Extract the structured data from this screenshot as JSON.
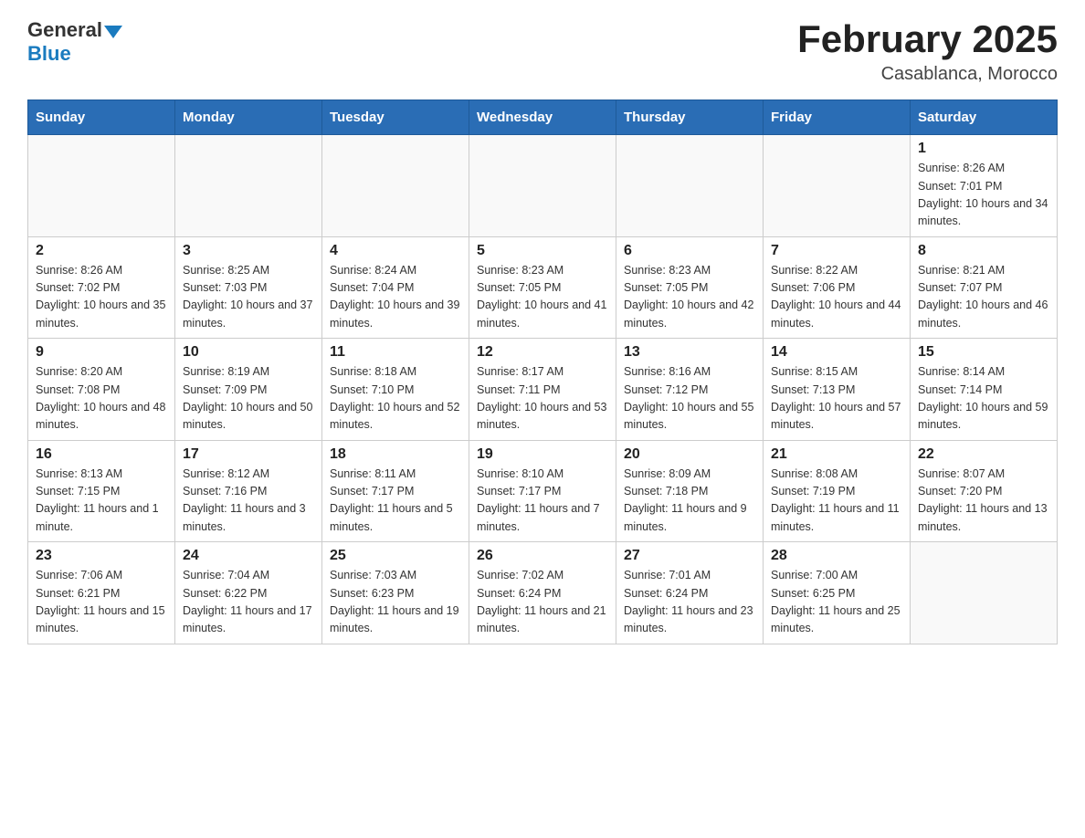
{
  "header": {
    "logo_general": "General",
    "logo_blue": "Blue",
    "month_title": "February 2025",
    "location": "Casablanca, Morocco"
  },
  "weekdays": [
    "Sunday",
    "Monday",
    "Tuesday",
    "Wednesday",
    "Thursday",
    "Friday",
    "Saturday"
  ],
  "weeks": [
    [
      {
        "day": "",
        "info": ""
      },
      {
        "day": "",
        "info": ""
      },
      {
        "day": "",
        "info": ""
      },
      {
        "day": "",
        "info": ""
      },
      {
        "day": "",
        "info": ""
      },
      {
        "day": "",
        "info": ""
      },
      {
        "day": "1",
        "info": "Sunrise: 8:26 AM\nSunset: 7:01 PM\nDaylight: 10 hours and 34 minutes."
      }
    ],
    [
      {
        "day": "2",
        "info": "Sunrise: 8:26 AM\nSunset: 7:02 PM\nDaylight: 10 hours and 35 minutes."
      },
      {
        "day": "3",
        "info": "Sunrise: 8:25 AM\nSunset: 7:03 PM\nDaylight: 10 hours and 37 minutes."
      },
      {
        "day": "4",
        "info": "Sunrise: 8:24 AM\nSunset: 7:04 PM\nDaylight: 10 hours and 39 minutes."
      },
      {
        "day": "5",
        "info": "Sunrise: 8:23 AM\nSunset: 7:05 PM\nDaylight: 10 hours and 41 minutes."
      },
      {
        "day": "6",
        "info": "Sunrise: 8:23 AM\nSunset: 7:05 PM\nDaylight: 10 hours and 42 minutes."
      },
      {
        "day": "7",
        "info": "Sunrise: 8:22 AM\nSunset: 7:06 PM\nDaylight: 10 hours and 44 minutes."
      },
      {
        "day": "8",
        "info": "Sunrise: 8:21 AM\nSunset: 7:07 PM\nDaylight: 10 hours and 46 minutes."
      }
    ],
    [
      {
        "day": "9",
        "info": "Sunrise: 8:20 AM\nSunset: 7:08 PM\nDaylight: 10 hours and 48 minutes."
      },
      {
        "day": "10",
        "info": "Sunrise: 8:19 AM\nSunset: 7:09 PM\nDaylight: 10 hours and 50 minutes."
      },
      {
        "day": "11",
        "info": "Sunrise: 8:18 AM\nSunset: 7:10 PM\nDaylight: 10 hours and 52 minutes."
      },
      {
        "day": "12",
        "info": "Sunrise: 8:17 AM\nSunset: 7:11 PM\nDaylight: 10 hours and 53 minutes."
      },
      {
        "day": "13",
        "info": "Sunrise: 8:16 AM\nSunset: 7:12 PM\nDaylight: 10 hours and 55 minutes."
      },
      {
        "day": "14",
        "info": "Sunrise: 8:15 AM\nSunset: 7:13 PM\nDaylight: 10 hours and 57 minutes."
      },
      {
        "day": "15",
        "info": "Sunrise: 8:14 AM\nSunset: 7:14 PM\nDaylight: 10 hours and 59 minutes."
      }
    ],
    [
      {
        "day": "16",
        "info": "Sunrise: 8:13 AM\nSunset: 7:15 PM\nDaylight: 11 hours and 1 minute."
      },
      {
        "day": "17",
        "info": "Sunrise: 8:12 AM\nSunset: 7:16 PM\nDaylight: 11 hours and 3 minutes."
      },
      {
        "day": "18",
        "info": "Sunrise: 8:11 AM\nSunset: 7:17 PM\nDaylight: 11 hours and 5 minutes."
      },
      {
        "day": "19",
        "info": "Sunrise: 8:10 AM\nSunset: 7:17 PM\nDaylight: 11 hours and 7 minutes."
      },
      {
        "day": "20",
        "info": "Sunrise: 8:09 AM\nSunset: 7:18 PM\nDaylight: 11 hours and 9 minutes."
      },
      {
        "day": "21",
        "info": "Sunrise: 8:08 AM\nSunset: 7:19 PM\nDaylight: 11 hours and 11 minutes."
      },
      {
        "day": "22",
        "info": "Sunrise: 8:07 AM\nSunset: 7:20 PM\nDaylight: 11 hours and 13 minutes."
      }
    ],
    [
      {
        "day": "23",
        "info": "Sunrise: 7:06 AM\nSunset: 6:21 PM\nDaylight: 11 hours and 15 minutes."
      },
      {
        "day": "24",
        "info": "Sunrise: 7:04 AM\nSunset: 6:22 PM\nDaylight: 11 hours and 17 minutes."
      },
      {
        "day": "25",
        "info": "Sunrise: 7:03 AM\nSunset: 6:23 PM\nDaylight: 11 hours and 19 minutes."
      },
      {
        "day": "26",
        "info": "Sunrise: 7:02 AM\nSunset: 6:24 PM\nDaylight: 11 hours and 21 minutes."
      },
      {
        "day": "27",
        "info": "Sunrise: 7:01 AM\nSunset: 6:24 PM\nDaylight: 11 hours and 23 minutes."
      },
      {
        "day": "28",
        "info": "Sunrise: 7:00 AM\nSunset: 6:25 PM\nDaylight: 11 hours and 25 minutes."
      },
      {
        "day": "",
        "info": ""
      }
    ]
  ]
}
